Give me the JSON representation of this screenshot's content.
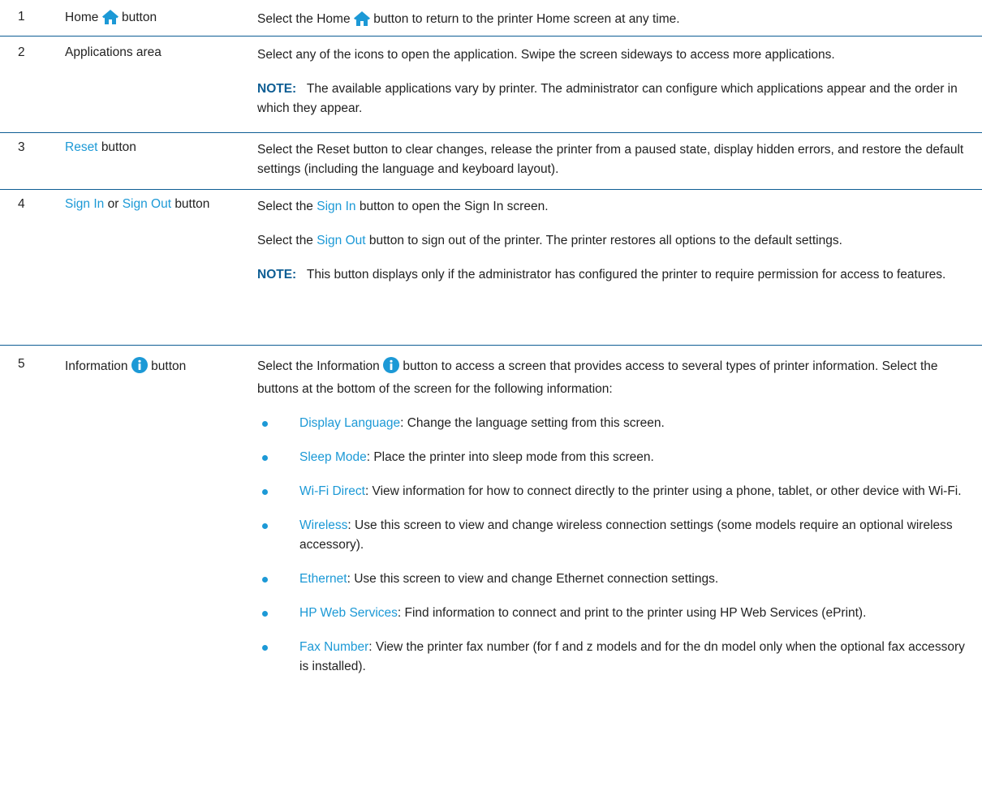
{
  "rows": [
    {
      "num": "1",
      "item": {
        "pre": "Home",
        "post": "button"
      },
      "desc": {
        "pre": "Select the Home",
        "post": "button to return to the printer Home screen at any time."
      }
    },
    {
      "num": "2",
      "item": {
        "text": "Applications area"
      },
      "desc": {
        "text": "Select any of the icons to open the application. Swipe the screen sideways to access more applications.",
        "note_label": "NOTE:",
        "note_text": "The available applications vary by printer. The administrator can configure which applications appear and the order in which they appear."
      }
    },
    {
      "num": "3",
      "item": {
        "link": "Reset",
        "post": "button"
      },
      "desc": {
        "text": "Select the Reset button to clear changes, release the printer from a paused state, display hidden errors, and restore the default settings (including the language and keyboard layout)."
      }
    },
    {
      "num": "4",
      "item": {
        "link1": "Sign In",
        "mid": "or",
        "link2": "Sign Out",
        "post": "button"
      },
      "desc": {
        "p1_pre": "Select the",
        "p1_link": "Sign In",
        "p1_post": "button to open the Sign In screen.",
        "p2_pre": "Select the",
        "p2_link": "Sign Out",
        "p2_post": "button to sign out of the printer. The printer restores all options to the default settings.",
        "note_label": "NOTE:",
        "note_text": "This button displays only if the administrator has configured the printer to require permission for access to features."
      }
    },
    {
      "num": "5",
      "item": {
        "pre": "Information",
        "post": "button"
      },
      "desc": {
        "pre": "Select the Information",
        "post": "button to access a screen that provides access to several types of printer information. Select the buttons at the bottom of the screen for the following information:",
        "bullets": [
          {
            "link": "Display Language",
            "text": ": Change the language setting from this screen."
          },
          {
            "link": "Sleep Mode",
            "text": ": Place the printer into sleep mode from this screen."
          },
          {
            "link": "Wi-Fi Direct",
            "text": ": View information for how to connect directly to the printer using a phone, tablet, or other device with Wi-Fi."
          },
          {
            "link": "Wireless",
            "text": ": Use this screen to view and change wireless connection settings (some models require an optional wireless accessory)."
          },
          {
            "link": "Ethernet",
            "text": ": Use this screen to view and change Ethernet connection settings."
          },
          {
            "link": "HP Web Services",
            "text": ": Find information to connect and print to the printer using HP Web Services (ePrint)."
          },
          {
            "link": "Fax Number",
            "text": ": View the printer fax number (for f and z models and for the dn model only when the optional fax accessory is installed)."
          }
        ]
      }
    }
  ],
  "colors": {
    "link": "#1c99d6",
    "rule": "#0e5e94",
    "text": "#222222"
  },
  "icons": {
    "home": "home-icon",
    "info": "info-icon"
  }
}
